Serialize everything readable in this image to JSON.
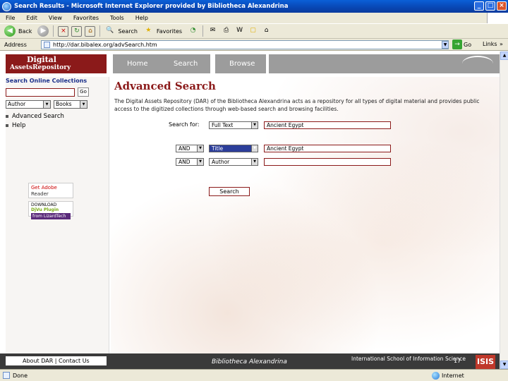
{
  "window": {
    "title": "Search Results - Microsoft Internet Explorer provided by Bibliotheca Alexandrina",
    "minimize": "_",
    "maximize": "□",
    "close": "×"
  },
  "menu": [
    "File",
    "Edit",
    "View",
    "Favorites",
    "Tools",
    "Help"
  ],
  "toolbar": {
    "back": "Back",
    "search": "Search",
    "favorites": "Favorites"
  },
  "address": {
    "label": "Address",
    "url": "http://dar.bibalex.org/advSearch.htm",
    "go": "Go",
    "links": "Links",
    "chevron": "»"
  },
  "site": {
    "logo_line1": "Digital",
    "logo_line2a": "Assets",
    "logo_line2b": "Repository",
    "nav": {
      "home": "Home",
      "search": "Search",
      "browse": "Browse"
    }
  },
  "sidebar": {
    "title": "Search Online Collections",
    "go": "Go",
    "field_select": "Author",
    "type_select": "Books",
    "links": [
      "Advanced Search",
      "Help"
    ],
    "adobe_line1": "Get Adobe",
    "adobe_line2": "Reader",
    "djvu_line1": "DOWNLOAD",
    "djvu_line2": "DjVu Plugin",
    "djvu_line3": "from LizardTech"
  },
  "main": {
    "title": "Advanced Search",
    "description": "The Digital Assets Repository (DAR) of the Bibliotheca Alexandrina acts as a repository for all types of digital material and provides public access to the digitized collections through web-based search and browsing facilities.",
    "search_for_label": "Search for:",
    "row1": {
      "field": "Full Text",
      "value": "Ancient Egypt"
    },
    "row2": {
      "op": "AND",
      "field": "Title",
      "value": "Ancient Egypt"
    },
    "row3": {
      "op": "AND",
      "field": "Author",
      "value": ""
    },
    "search_button": "Search"
  },
  "footer": {
    "left": "About DAR | Contact Us",
    "middle": "Bibliotheca Alexandrina",
    "right": "International School of Information Science",
    "logo": "ISIS"
  },
  "page_number": "17",
  "status": {
    "text": "Done",
    "zone": "Internet"
  }
}
